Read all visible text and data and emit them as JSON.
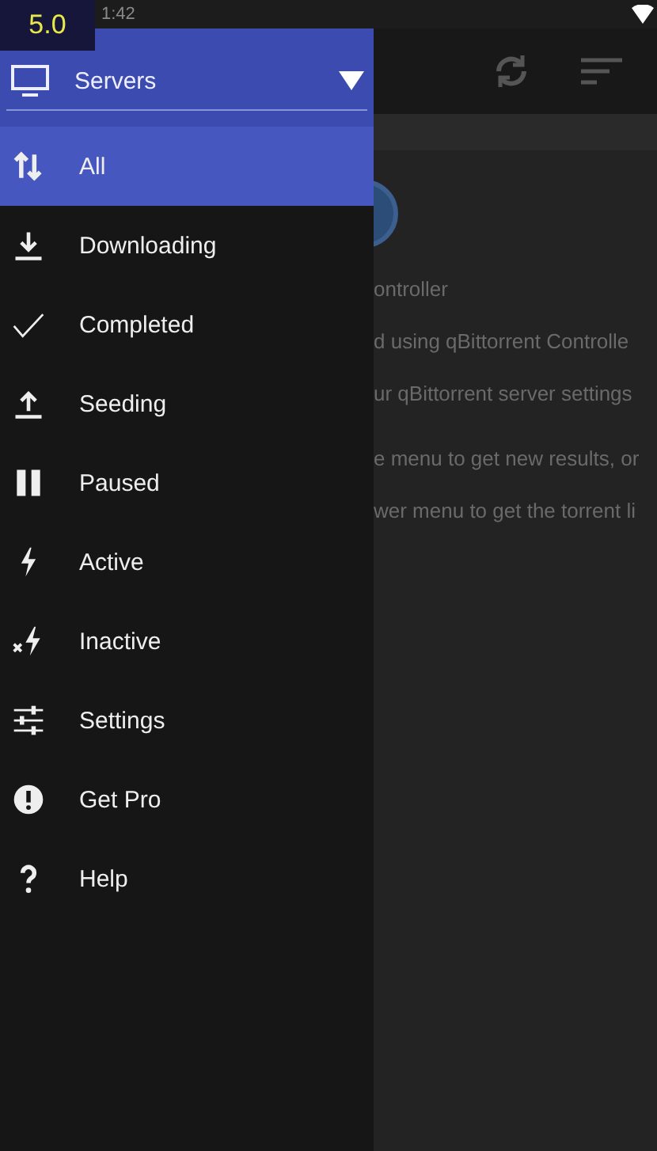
{
  "status_bar": {
    "time": "1:42",
    "overlay_badge": "5.0"
  },
  "drawer": {
    "server_selector": {
      "label": "Servers",
      "expanded": false
    },
    "items": [
      {
        "kind": "all",
        "label": "All",
        "selected": true
      },
      {
        "kind": "downloading",
        "label": "Downloading",
        "selected": false
      },
      {
        "kind": "completed",
        "label": "Completed",
        "selected": false
      },
      {
        "kind": "seeding",
        "label": "Seeding",
        "selected": false
      },
      {
        "kind": "paused",
        "label": "Paused",
        "selected": false
      },
      {
        "kind": "active",
        "label": "Active",
        "selected": false
      },
      {
        "kind": "inactive",
        "label": "Inactive",
        "selected": false
      },
      {
        "kind": "settings",
        "label": "Settings",
        "selected": false
      },
      {
        "kind": "pro",
        "label": "Get Pro",
        "selected": false
      },
      {
        "kind": "help",
        "label": "Help",
        "selected": false
      }
    ]
  },
  "main": {
    "lines": [
      "ontroller",
      "d using qBittorrent Controlle",
      "ur qBittorrent server settings",
      "e menu to get new results, or",
      "wer menu to get the torrent li"
    ]
  }
}
